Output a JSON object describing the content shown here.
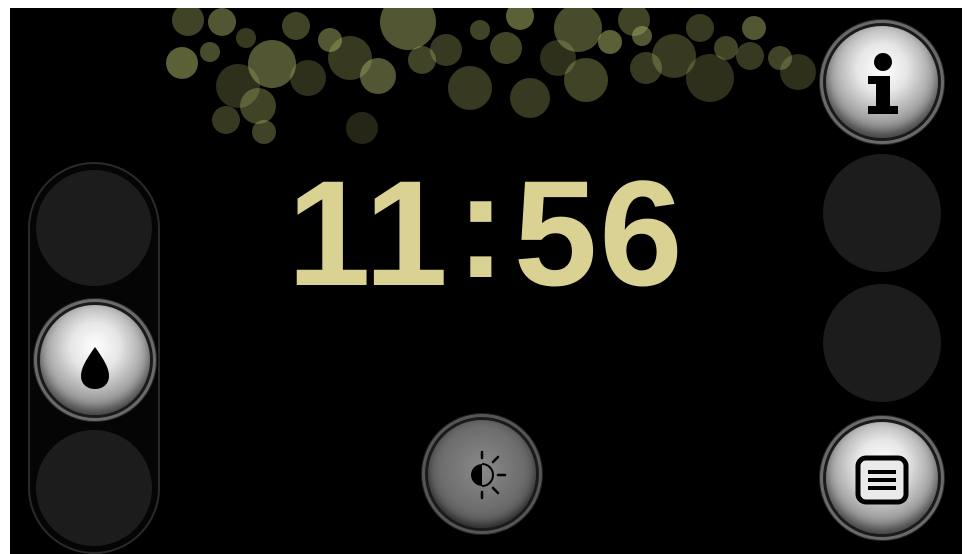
{
  "clock": {
    "hours": "11",
    "separator": ":",
    "minutes": "56"
  },
  "buttons": {
    "info": {
      "icon": "info-icon"
    },
    "water": {
      "icon": "water-drop-icon"
    },
    "brightness": {
      "icon": "brightness-icon"
    },
    "menu": {
      "icon": "menu-list-icon"
    }
  },
  "colors": {
    "clock": "#d9d293",
    "background": "#000000",
    "bokeh": "#b7bf6e"
  }
}
